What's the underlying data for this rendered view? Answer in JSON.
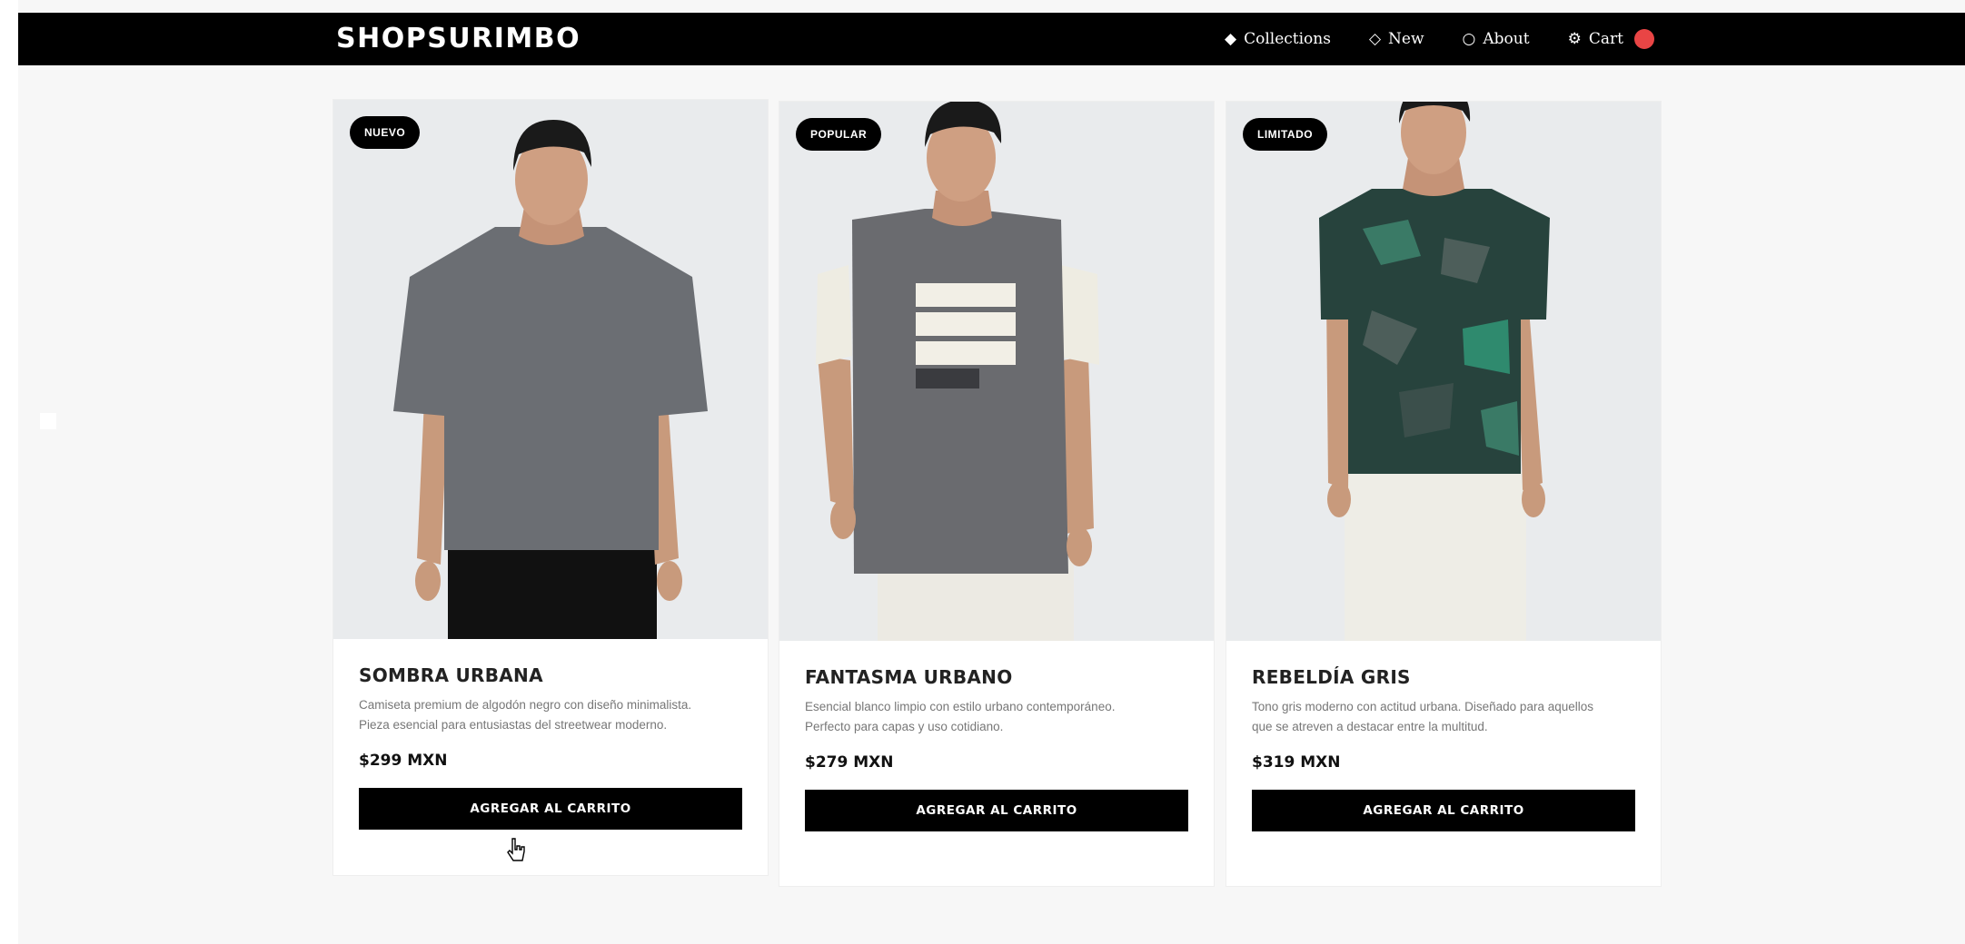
{
  "header": {
    "logo": "SHOPSURIMBO",
    "nav": [
      {
        "icon": "diamond-filled-icon",
        "label": "Collections"
      },
      {
        "icon": "diamond-outline-icon",
        "label": "New"
      },
      {
        "icon": "circle-outline-icon",
        "label": "About"
      },
      {
        "icon": "gear-icon",
        "label": "Cart"
      }
    ],
    "cart_badge_color": "#e94545"
  },
  "products": [
    {
      "badge": "NUEVO",
      "title": "SOMBRA URBANA",
      "description": "Camiseta premium de algodón negro con diseño minimalista. Pieza esencial para entusiastas del streetwear moderno.",
      "price": "$299 MXN",
      "button": "AGREGAR AL CARRITO",
      "shirt_color": "#6b6e73",
      "pants_color": "#111111"
    },
    {
      "badge": "POPULAR",
      "title": "FANTASMA URBANO",
      "description": "Esencial blanco limpio con estilo urbano contemporáneo. Perfecto para capas y uso cotidiano.",
      "price": "$279 MXN",
      "button": "AGREGAR AL CARRITO",
      "shirt_color": "#6a6b6f",
      "pants_color": "#eceae3"
    },
    {
      "badge": "LIMITADO",
      "title": "REBELDÍA GRIS",
      "description": "Tono gris moderno con actitud urbana. Diseñado para aquellos que se atreven a destacar entre la multitud.",
      "price": "$319 MXN",
      "button": "AGREGAR AL CARRITO",
      "shirt_color": "#27433d",
      "pants_color": "#eeede6"
    }
  ]
}
